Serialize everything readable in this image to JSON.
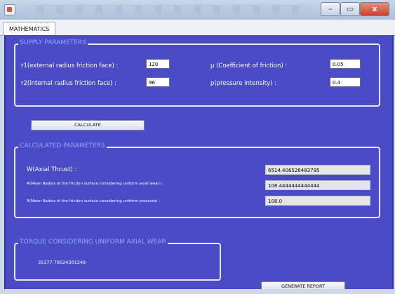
{
  "window": {
    "minimize_glyph": "–",
    "maximize_glyph": "▭",
    "close_glyph": "x"
  },
  "tabs": [
    {
      "label": "MATHEMATICS",
      "selected": true
    }
  ],
  "supply": {
    "title": "SUPPLY PARAMETERS",
    "r1_label": "r1(external radius friction face) :",
    "r1_value": "120",
    "r2_label": "r2(internal radius friction face) :",
    "r2_value": "96",
    "mu_label": "µ (Coefficient of friction) :",
    "mu_value": "0.05",
    "p_label": "p(pressure intensity) :",
    "p_value": "0.4"
  },
  "calculate_label": "CALCULATE",
  "calculated": {
    "title": "CALCULATED PARAMETERS",
    "w_label": "W(Axial Thrust) :",
    "w_value": "6514.406526483795",
    "r_wear_label": "R(Mean Radius of the friction surface considering uniform axial wear) :",
    "r_wear_value": "108.4444444444444",
    "r_pressure_label": "R(Mean Radius of the friction surface considering uniform pressure) :",
    "r_pressure_value": "108.0"
  },
  "torque": {
    "title": "TORQUE CONSIDERING UNIFORM AXIAL WEAR",
    "value": "35177.79524301249"
  },
  "generate_report_label": "GENERATE REPORT",
  "colors": {
    "panel": "#4b4bc8",
    "legend": "#8fa8ff",
    "border": "#e8e8ff"
  },
  "icons": [
    "app-icon",
    "minimize-icon",
    "maximize-icon",
    "close-icon"
  ]
}
